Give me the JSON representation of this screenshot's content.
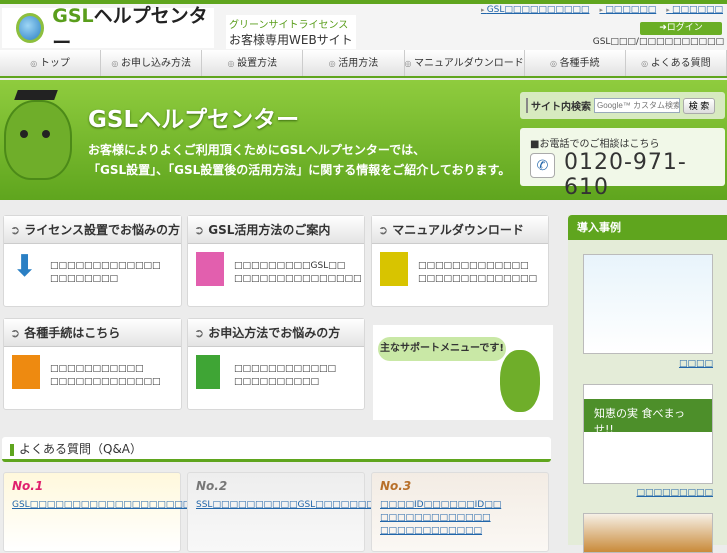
{
  "header": {
    "logo_brand": "GSL",
    "logo_text": "ヘルプセンター",
    "tagline_1": "グリーンサイトライセンス",
    "tagline_2": "お客様専用WEBサイト",
    "top_links": [
      "GSL□□□□□□□□□□",
      "□□□□□□",
      "□□□□□□"
    ],
    "login": "➜ログイン",
    "user_line": "GSL□□□/□□□□□□□□□□"
  },
  "nav": [
    "トップ",
    "お申し込み方法",
    "設置方法",
    "活用方法",
    "マニュアルダウンロード",
    "各種手続",
    "よくある質問"
  ],
  "banner": {
    "title": "GSLヘルプセンター",
    "desc_1": "お客様によりよくご利用頂くためにGSLヘルプセンターでは、",
    "desc_2": "「GSL設置」、「GSL設置後の活用方法」に関する情報をご紹介しております。",
    "search_label": "サイト内検索",
    "search_placeholder": "Google™ カスタム検索",
    "search_button": "検 索",
    "phone_label": "■お電話でのご相談はこちら",
    "phone_number": "0120-971-610"
  },
  "cards": [
    {
      "title": "ライセンス設置でお悩みの方",
      "l1": "□□□□□□□□□□□□□",
      "l2": "□□□□□□□□"
    },
    {
      "title": "GSL活用方法のご案内",
      "l1": "□□□□□□□□□GSL□□",
      "l2": "□□□□□□□□□□□□□□□"
    },
    {
      "title": "マニュアルダウンロード",
      "l1": "□□□□□□□□□□□□□",
      "l2": "□□□□□□□□□□□□□□"
    },
    {
      "title": "各種手続はこちら",
      "l1": "□□□□□□□□□□□",
      "l2": "□□□□□□□□□□□□□"
    },
    {
      "title": "お申込方法でお悩みの方",
      "l1": "□□□□□□□□□□□□",
      "l2": "□□□□□□□□□□"
    }
  ],
  "mascot_bubble": "主なサポートメニューです!",
  "qa": {
    "title": "よくある質問（Q&A）",
    "items": [
      {
        "rank": "No.1",
        "text": "GSL□□□□□□□□□□□□□□□□□□□□□□□□□□□"
      },
      {
        "rank": "No.2",
        "text": "SSL□□□□□□□□□□GSL□□□□□□□□□□□□□□□□"
      },
      {
        "rank": "No.3",
        "text": "□□□□ID□□□□□□ID□□ □□□□□□□□□□□□□ □□□□□□□□□□□□"
      }
    ]
  },
  "sidebar": {
    "title": "導入事例",
    "links": [
      "□□□□",
      "□□□□□□□□□"
    ],
    "shot2_text": "知恵の実 食べまっせ!!"
  }
}
